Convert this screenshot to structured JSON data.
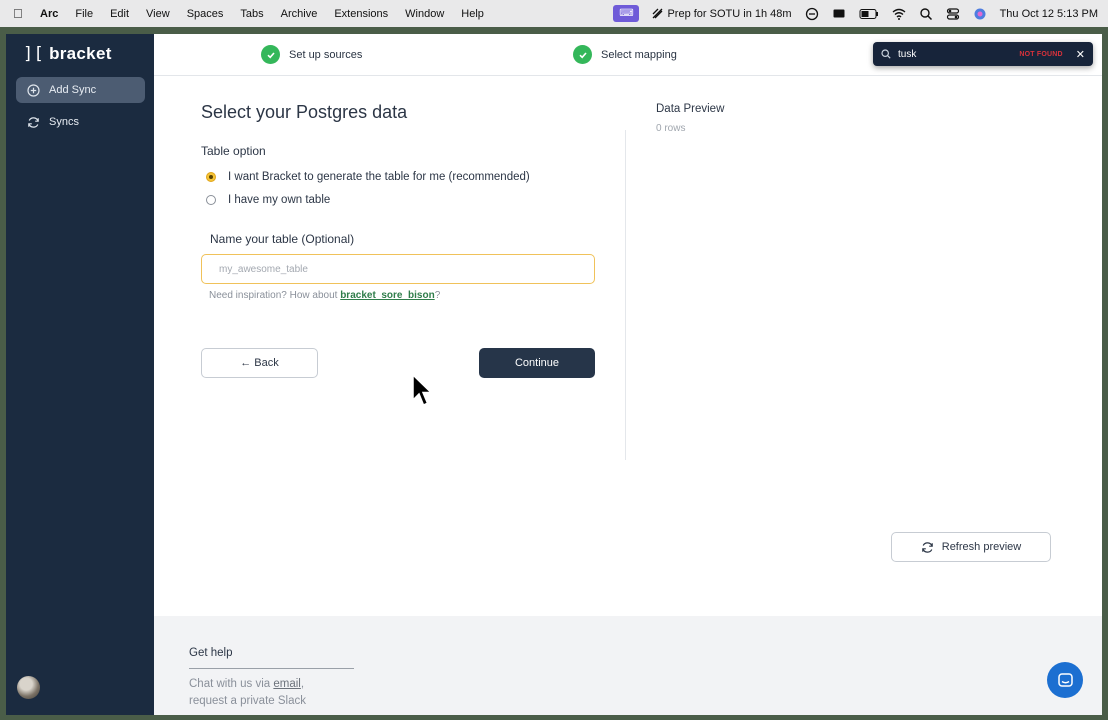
{
  "menubar": {
    "app": "Arc",
    "items": [
      "File",
      "Edit",
      "View",
      "Spaces",
      "Tabs",
      "Archive",
      "Extensions",
      "Window",
      "Help"
    ],
    "event": "Prep for SOTU in 1h 48m",
    "datetime": "Thu Oct 12  5:13 PM"
  },
  "sidebar": {
    "brand": "bracket",
    "brand_mark": "][",
    "items": [
      {
        "label": "Add Sync",
        "icon": "plus-circle-icon"
      },
      {
        "label": "Syncs",
        "icon": "refresh-icon"
      }
    ]
  },
  "steps": [
    {
      "label": "Set up sources",
      "status": "complete"
    },
    {
      "label": "Select mapping",
      "status": "complete"
    }
  ],
  "find": {
    "query": "tusk",
    "status": "NOT FOUND"
  },
  "form": {
    "title": "Select your Postgres data",
    "table_option_label": "Table option",
    "options": [
      "I want Bracket to generate the table for me (recommended)",
      "I have my own table"
    ],
    "name_label": "Name your table (Optional)",
    "name_placeholder": "my_awesome_table",
    "hint_prefix": "Need inspiration? How about ",
    "hint_link": "bracket_sore_bison",
    "hint_suffix": "?",
    "back_label": "← Back",
    "continue_label": "Continue"
  },
  "preview": {
    "title": "Data Preview",
    "rows": "0 rows",
    "refresh_label": "Refresh preview"
  },
  "footer": {
    "title": "Get help",
    "line1_prefix": "Chat with us via ",
    "line1_link": "email",
    "line1_suffix": ",",
    "line2": "request a private Slack"
  },
  "colors": {
    "sidebar_bg": "#1b2b40",
    "sidebar_active": "#4c5c72",
    "primary_button": "#263549",
    "step_complete": "#34b75a",
    "input_focus": "#f0c25a",
    "link": "#2f7d4a",
    "chat_bubble": "#1c6fd1",
    "not_found": "#d8313a"
  }
}
